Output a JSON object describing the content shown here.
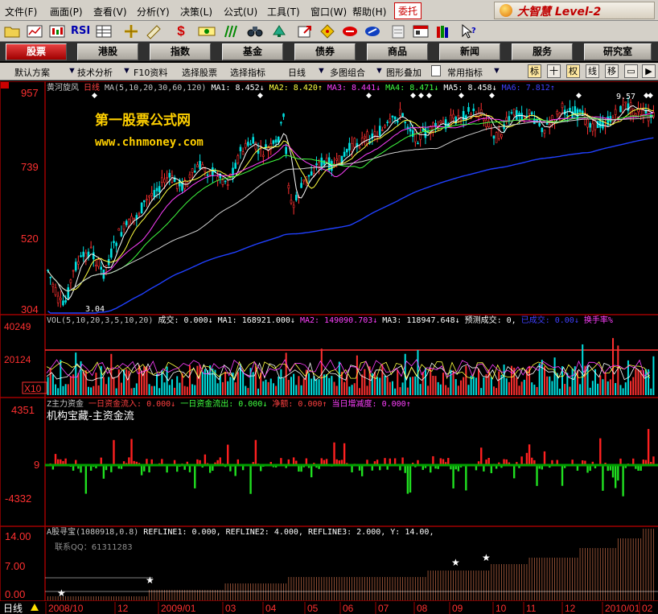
{
  "menubar": {
    "items": [
      "文件(F)",
      "画面(P)",
      "查看(V)",
      "分析(Y)",
      "决策(L)",
      "公式(U)",
      "工具(T)",
      "窗口(W)",
      "帮助(H)"
    ],
    "entrust": "委托",
    "brand": "大智慧 Level-2"
  },
  "toolbar": {
    "icons": [
      "open-folder-icon",
      "chart-view-icon",
      "kline-icon",
      "rsi-icon",
      "table-icon",
      "crosshair-icon",
      "ruler-icon",
      "dollar-icon",
      "indicator-icon",
      "bars-icon",
      "binoculars-icon",
      "alarm-icon",
      "export-icon",
      "diamond-icon",
      "f10-icon",
      "lines-icon",
      "notepad-icon",
      "window-icon",
      "books-icon",
      "help-pointer-icon"
    ],
    "rsi_label": "RSI",
    "dollar_label": "$"
  },
  "nav": {
    "tabs": [
      "股票",
      "港股",
      "指数",
      "基金",
      "债券",
      "商品",
      "新闻",
      "服务",
      "研究室"
    ],
    "active": "股票"
  },
  "subbar": {
    "items": [
      "默认方案",
      "技术分析",
      "F10资料",
      "选择股票",
      "选择指标",
      "日线",
      "多图组合",
      "图形叠加",
      "常用指标"
    ],
    "right_buttons": [
      "标",
      "十",
      "权",
      "线",
      "移"
    ]
  },
  "watermark": {
    "title": "第一股票公式网",
    "url": "www.chnmoney.com"
  },
  "price_panel": {
    "legend": [
      {
        "text": "黄河旋风",
        "color": "#c8c8c8"
      },
      {
        "text": "日线",
        "color": "#ff4040"
      },
      {
        "text": "MA(5,10,20,30,60,120)",
        "color": "#c8c8c8"
      },
      {
        "text": "MA1: 8.452↓",
        "color": "#ffffff"
      },
      {
        "text": "MA2: 8.420↑",
        "color": "#ffff40"
      },
      {
        "text": "MA3: 8.441↓",
        "color": "#ff40ff"
      },
      {
        "text": "MA4: 8.471↓",
        "color": "#40ff40"
      },
      {
        "text": "MA5: 8.458↓",
        "color": "#ffffff"
      },
      {
        "text": "MA6: 7.812↑",
        "color": "#4040ff"
      }
    ],
    "y_labels": [
      "957",
      "739",
      "520",
      "304"
    ],
    "high_marker": "9.57",
    "low_marker": "3.04"
  },
  "volume_panel": {
    "legend": [
      {
        "text": "VOL(5,10,20,3,5,10,20)",
        "color": "#c8c8c8"
      },
      {
        "text": "成交: 0.000↓",
        "color": "#ffffff"
      },
      {
        "text": "MA1: 168921.000↓",
        "color": "#ffffff"
      },
      {
        "text": "MA2: 149090.703↓",
        "color": "#ff40ff"
      },
      {
        "text": "MA3: 118947.648↓",
        "color": "#ffffff"
      },
      {
        "text": "预测成交: 0,",
        "color": "#ffffff"
      },
      {
        "text": "已成交: 0.00↓",
        "color": "#4040ff"
      },
      {
        "text": "换手率%",
        "color": "#ff40ff"
      }
    ],
    "y_labels": [
      "40249",
      "20124",
      "X10"
    ]
  },
  "capital_panel": {
    "legend": [
      {
        "text": "Z主力资金",
        "color": "#c8c8c8"
      },
      {
        "text": "一日资金流入: 0.000↓",
        "color": "#ff4040"
      },
      {
        "text": "一日资金流出: 0.000↓",
        "color": "#40ff40"
      },
      {
        "text": "净额: 0.000↑",
        "color": "#ff4040"
      },
      {
        "text": "当日增减度: 0.000↑",
        "color": "#ff40ff"
      }
    ],
    "title": "机构宝藏-主资金流",
    "y_labels": [
      "4351",
      "9",
      "-4332"
    ]
  },
  "signal_panel": {
    "legend": [
      {
        "text": "A股寻宝(1080918,0.8)",
        "color": "#c8c8c8"
      },
      {
        "text": "REFLINE1: 0.000,",
        "color": "#ffffff"
      },
      {
        "text": "REFLINE2: 4.000,",
        "color": "#ffffff"
      },
      {
        "text": "REFLINE3: 2.000,",
        "color": "#ffffff"
      },
      {
        "text": "Y: 14.00,",
        "color": "#ffffff"
      }
    ],
    "contact": "联系QQ：61311283",
    "y_labels": [
      "14.00",
      "7.00",
      "0.00"
    ]
  },
  "x_axis": {
    "period": "日线",
    "labels": [
      "2008/10",
      "12",
      "2009/01",
      "03",
      "04",
      "05",
      "06",
      "07",
      "08",
      "09",
      "10",
      "11",
      "12",
      "2010/01",
      "02"
    ]
  }
}
